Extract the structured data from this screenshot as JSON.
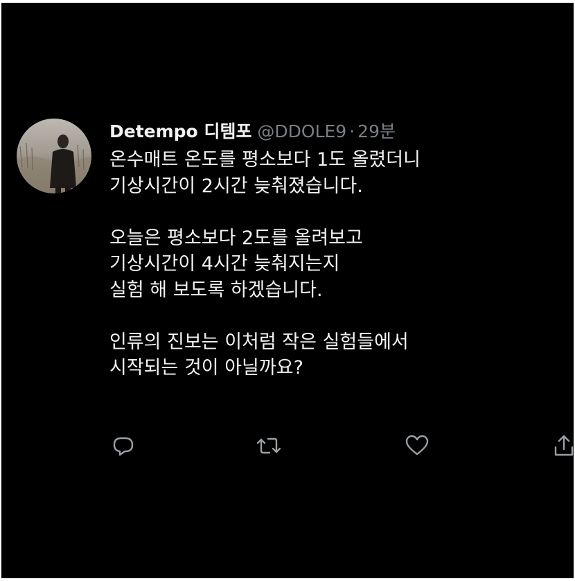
{
  "tweet": {
    "author_name": "Detempo 디템포",
    "handle": "@DDOLE9",
    "separator": "·",
    "time": "29분",
    "paragraphs": [
      [
        "온수매트 온도를 평소보다 1도 올렸더니",
        "기상시간이 2시간 늦춰졌습니다."
      ],
      [
        "오늘은 평소보다 2도를 올려보고",
        "기상시간이 4시간 늦춰지는지",
        "실험 해 보도록 하겠습니다."
      ],
      [
        "인류의 진보는 이처럼 작은 실험들에서",
        "시작되는 것이 아닐까요?"
      ]
    ]
  },
  "actions": {
    "reply_icon": "reply-icon",
    "retweet_icon": "retweet-icon",
    "like_icon": "heart-icon",
    "share_icon": "share-icon"
  },
  "colors": {
    "background": "#000000",
    "text": "#f2f2f2",
    "muted": "#7a7f85",
    "icon": "#9aa0a6"
  }
}
